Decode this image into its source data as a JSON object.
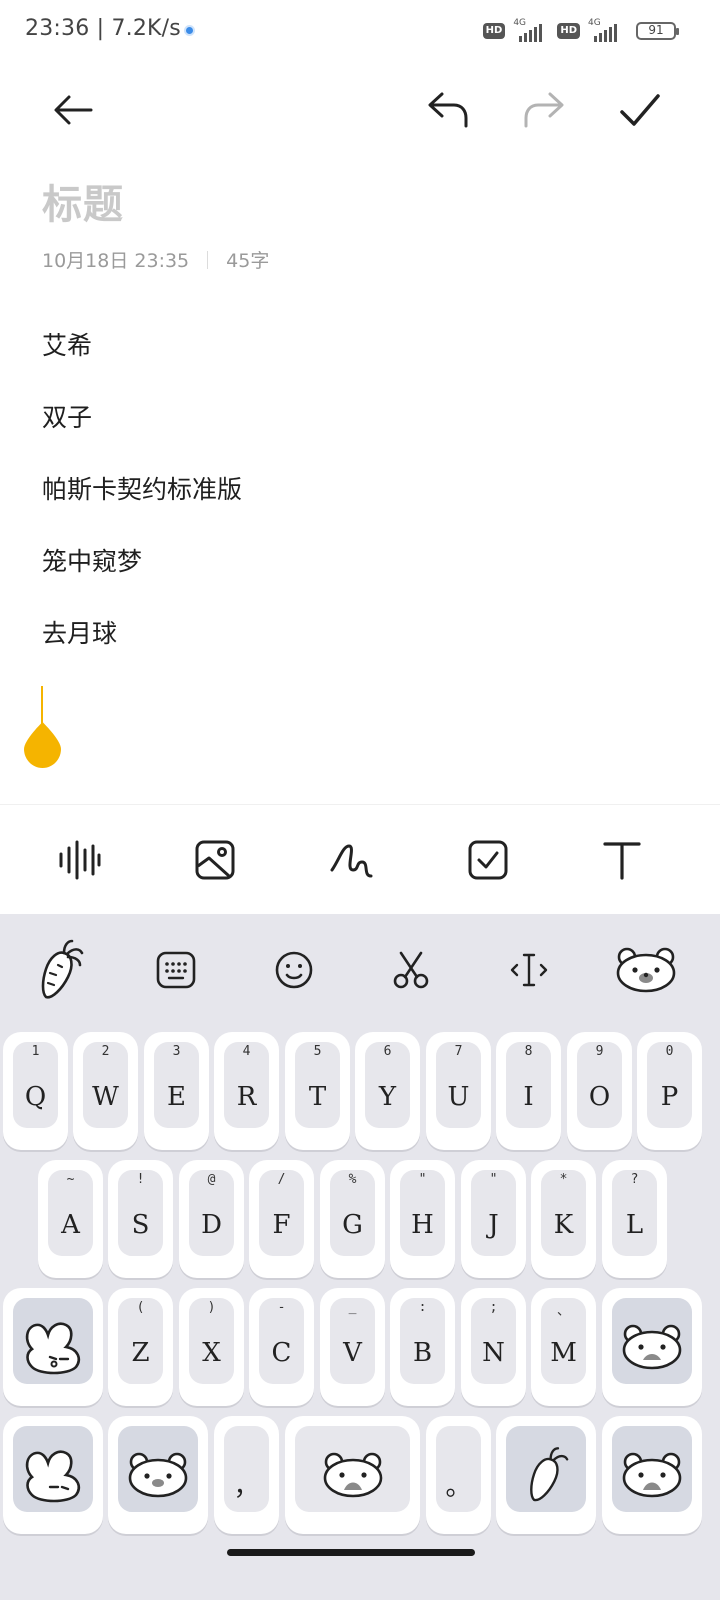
{
  "status_bar": {
    "time": "23:36",
    "separator": "|",
    "net_speed": "7.2K/s",
    "hd_badge": "HD",
    "network": "4G",
    "battery": "91"
  },
  "toolbar": {
    "back_icon": "arrow-left-icon",
    "undo_icon": "undo-icon",
    "redo_icon": "redo-icon",
    "confirm_icon": "check-icon"
  },
  "note": {
    "title_placeholder": "标题",
    "date": "10月18日 23:35",
    "char_count": "45字",
    "lines": [
      "艾希",
      "双子",
      "帕斯卡契约标准版",
      "笼中窥梦",
      "去月球"
    ]
  },
  "edit_tools": [
    "voice-icon",
    "image-icon",
    "handwriting-icon",
    "checklist-icon",
    "text-format-icon"
  ],
  "keyboard": {
    "toolbar": [
      "carrot-icon",
      "keyboard-icon",
      "emoji-icon",
      "scissors-icon",
      "cursor-icon",
      "bear-icon"
    ],
    "row1": [
      {
        "main": "Q",
        "sub": "1"
      },
      {
        "main": "W",
        "sub": "2"
      },
      {
        "main": "E",
        "sub": "3"
      },
      {
        "main": "R",
        "sub": "4"
      },
      {
        "main": "T",
        "sub": "5"
      },
      {
        "main": "Y",
        "sub": "6"
      },
      {
        "main": "U",
        "sub": "7"
      },
      {
        "main": "I",
        "sub": "8"
      },
      {
        "main": "O",
        "sub": "9"
      },
      {
        "main": "P",
        "sub": "0"
      }
    ],
    "row2": [
      {
        "main": "A",
        "sub": "~"
      },
      {
        "main": "S",
        "sub": "!"
      },
      {
        "main": "D",
        "sub": "@"
      },
      {
        "main": "F",
        "sub": "/"
      },
      {
        "main": "G",
        "sub": "%"
      },
      {
        "main": "H",
        "sub": "\""
      },
      {
        "main": "J",
        "sub": "\""
      },
      {
        "main": "K",
        "sub": "*"
      },
      {
        "main": "L",
        "sub": "?"
      }
    ],
    "row3": [
      {
        "main": "Z",
        "sub": "("
      },
      {
        "main": "X",
        "sub": ")"
      },
      {
        "main": "C",
        "sub": "-"
      },
      {
        "main": "V",
        "sub": "_"
      },
      {
        "main": "B",
        "sub": ":"
      },
      {
        "main": "N",
        "sub": ";"
      },
      {
        "main": "M",
        "sub": "、"
      }
    ],
    "comma": "，",
    "period": "。"
  },
  "colors": {
    "accent": "#f5b400",
    "keyboard_bg": "#e6e6ec"
  }
}
